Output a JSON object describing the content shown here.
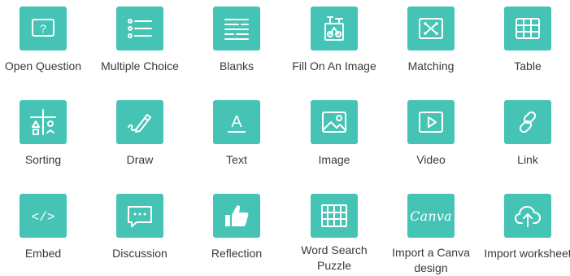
{
  "tiles": [
    {
      "label": "Open Question"
    },
    {
      "label": "Multiple Choice"
    },
    {
      "label": "Blanks"
    },
    {
      "label": "Fill On An Image"
    },
    {
      "label": "Matching"
    },
    {
      "label": "Table"
    },
    {
      "label": "Sorting"
    },
    {
      "label": "Draw"
    },
    {
      "label": "Text"
    },
    {
      "label": "Image"
    },
    {
      "label": "Video"
    },
    {
      "label": "Link"
    },
    {
      "label": "Embed"
    },
    {
      "label": "Discussion"
    },
    {
      "label": "Reflection"
    },
    {
      "label": "Word Search Puzzle"
    },
    {
      "label": "Import a Canva design"
    },
    {
      "label": "Import worksheet"
    }
  ],
  "icon_text": {
    "open_question": "?",
    "text": "A",
    "embed": "</>",
    "canva": "Canva"
  },
  "colors": {
    "tile_bg": "#45c4b6",
    "icon": "#ffffff",
    "label": "#3a3a3a"
  }
}
